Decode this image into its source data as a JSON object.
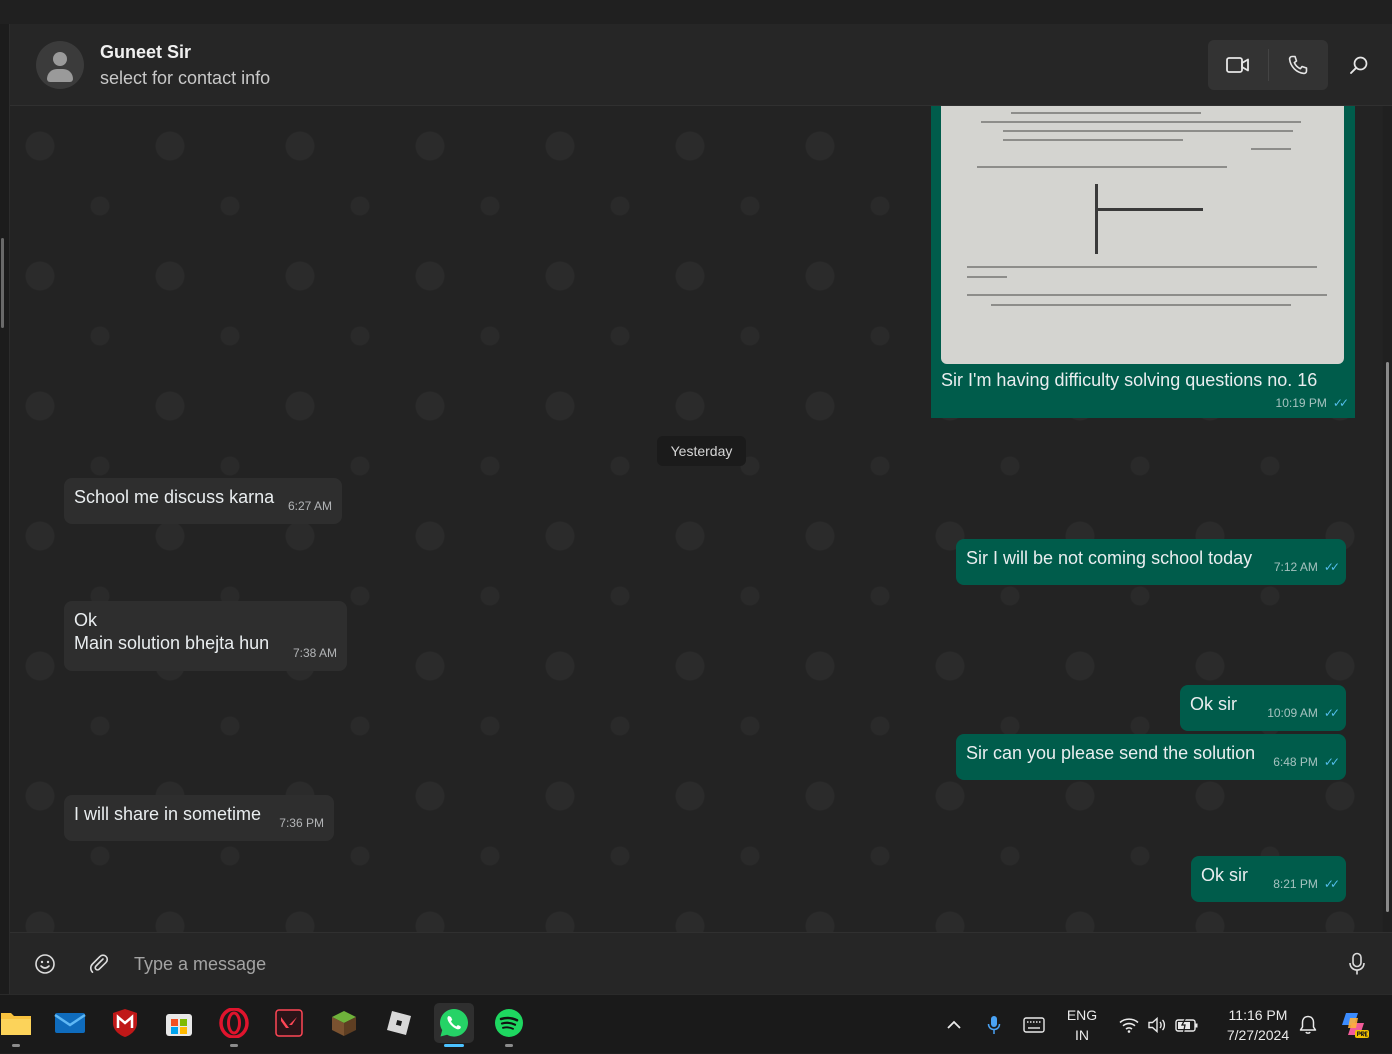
{
  "header": {
    "contact_name": "Guneet Sir",
    "contact_subtitle": "select for contact info"
  },
  "image_message": {
    "caption": "Sir I'm having difficulty solving questions no. 16",
    "time": "10:19 PM"
  },
  "date_separator": "Yesterday",
  "messages": [
    {
      "dir": "in",
      "lines": [
        "School me discuss karna"
      ],
      "time": "6:27 AM"
    },
    {
      "dir": "out",
      "lines": [
        "Sir I will be not coming school today"
      ],
      "time": "7:12 AM"
    },
    {
      "dir": "in",
      "lines": [
        "Ok",
        "Main solution bhejta hun"
      ],
      "time": "7:38 AM"
    },
    {
      "dir": "out",
      "lines": [
        "Ok sir"
      ],
      "time": "10:09 AM"
    },
    {
      "dir": "out",
      "lines": [
        "Sir can you please send the solution"
      ],
      "time": "6:48 PM"
    },
    {
      "dir": "in",
      "lines": [
        "I will share in sometime"
      ],
      "time": "7:36 PM"
    },
    {
      "dir": "out",
      "lines": [
        "Ok sir"
      ],
      "time": "8:21 PM"
    }
  ],
  "composer": {
    "placeholder": "Type a message"
  },
  "taskbar": {
    "apps": [
      "file-explorer",
      "mail",
      "mcafee",
      "microsoft-store",
      "opera",
      "valorant",
      "minecraft",
      "roblox",
      "whatsapp",
      "spotify"
    ],
    "language_line1": "ENG",
    "language_line2": "IN",
    "time": "11:16 PM",
    "date": "7/27/2024"
  },
  "colors": {
    "outgoing_bubble": "#005c4b",
    "incoming_bubble": "#2e2e2e",
    "read_ticks": "#53bdeb",
    "background": "#232323"
  }
}
